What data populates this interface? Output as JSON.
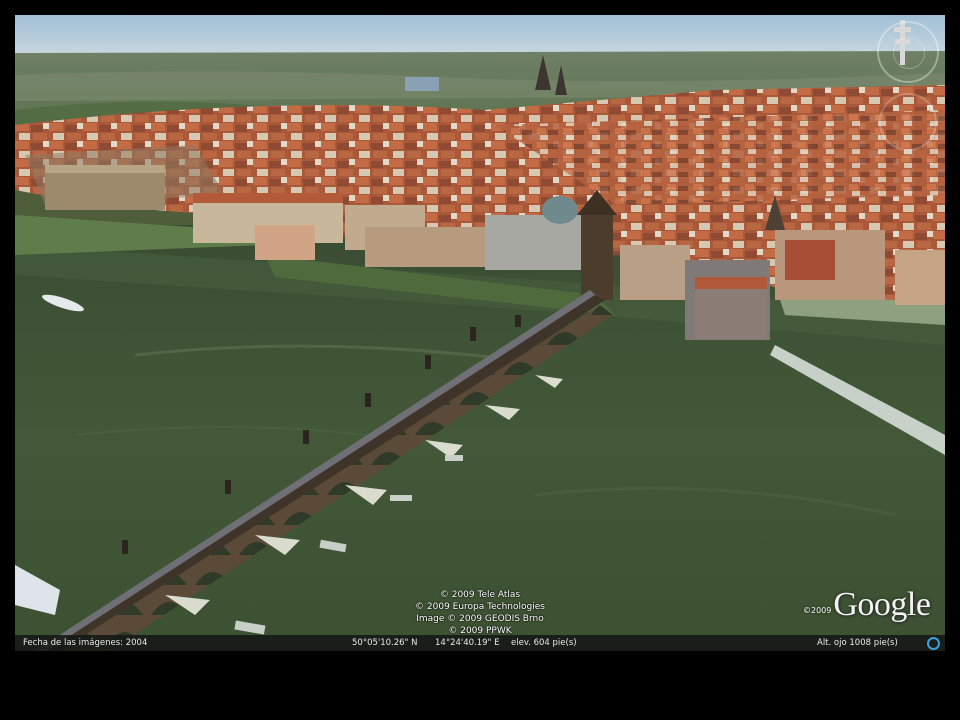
{
  "map": {
    "copyright_lines": [
      "© 2009 Tele Atlas",
      "© 2009 Europa Technologies",
      "Image © 2009 GEODIS Brno",
      "© 2009 PPWK"
    ],
    "logo_year": "©2009",
    "logo_text": "Google"
  },
  "status": {
    "imagery_date": "Fecha de las imágenes: 2004",
    "latitude": "50°05'10.26\" N",
    "longitude": "14°24'40.19\" E",
    "elevation": "elev.   604 pie(s)",
    "eye_altitude": "Alt. ojo      1008 pie(s)"
  },
  "colors": {
    "river": "#3f5236",
    "roofs": "#b8623f",
    "sky": "#a9c4d8",
    "bridge": "#6a5a46"
  }
}
